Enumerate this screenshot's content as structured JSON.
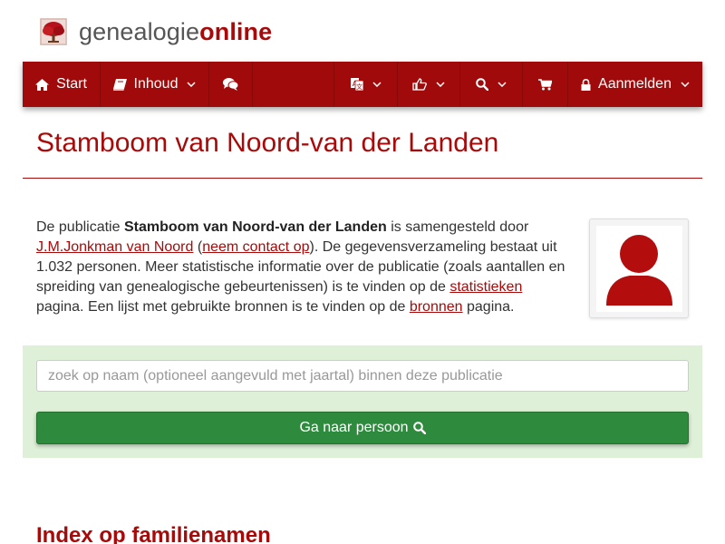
{
  "site": {
    "brand_part1": "genealogie",
    "brand_part2": "online",
    "brand_color": "#a80a0a"
  },
  "nav": {
    "bar_color": "#a00a0a",
    "items": [
      {
        "label": "Start",
        "icon": "home-icon"
      },
      {
        "label": "Inhoud",
        "icon": "book-icon"
      },
      {
        "label": "",
        "icon": "comments-icon"
      },
      {
        "label": "",
        "icon": "translate-icon"
      },
      {
        "label": "",
        "icon": "thumbs-up-icon"
      },
      {
        "label": "",
        "icon": "search-icon"
      },
      {
        "label": "",
        "icon": "cart-icon"
      },
      {
        "label": "Aanmelden",
        "icon": "lock-icon"
      }
    ]
  },
  "page": {
    "title": "Stamboom van Noord-van der Landen"
  },
  "intro": {
    "t1": "De publicatie ",
    "pub_name": "Stamboom van Noord-van der Landen",
    "t2": " is samengesteld door ",
    "author_link": "J.M.Jonkman van Noord",
    "t3": " (",
    "contact_link": "neem contact op",
    "t4": "). De gegevensverzameling bestaat uit 1.032 personen. Meer statistische informatie over de publicatie (zoals aantallen en spreiding van genealogische gebeurtenissen) is te vinden op de ",
    "stats_link": "statistieken",
    "t5": " pagina. Een lijst met gebruikte bronnen is te vinden op de ",
    "sources_link": "bronnen",
    "t6": " pagina."
  },
  "search": {
    "placeholder": "zoek op naam (optioneel aangevuld met jaartal) binnen deze publicatie",
    "button_label": "Ga naar persoon",
    "panel_color": "#dff0d8",
    "button_color": "#2e8b3e"
  },
  "index": {
    "title": "Index op familienamen"
  }
}
